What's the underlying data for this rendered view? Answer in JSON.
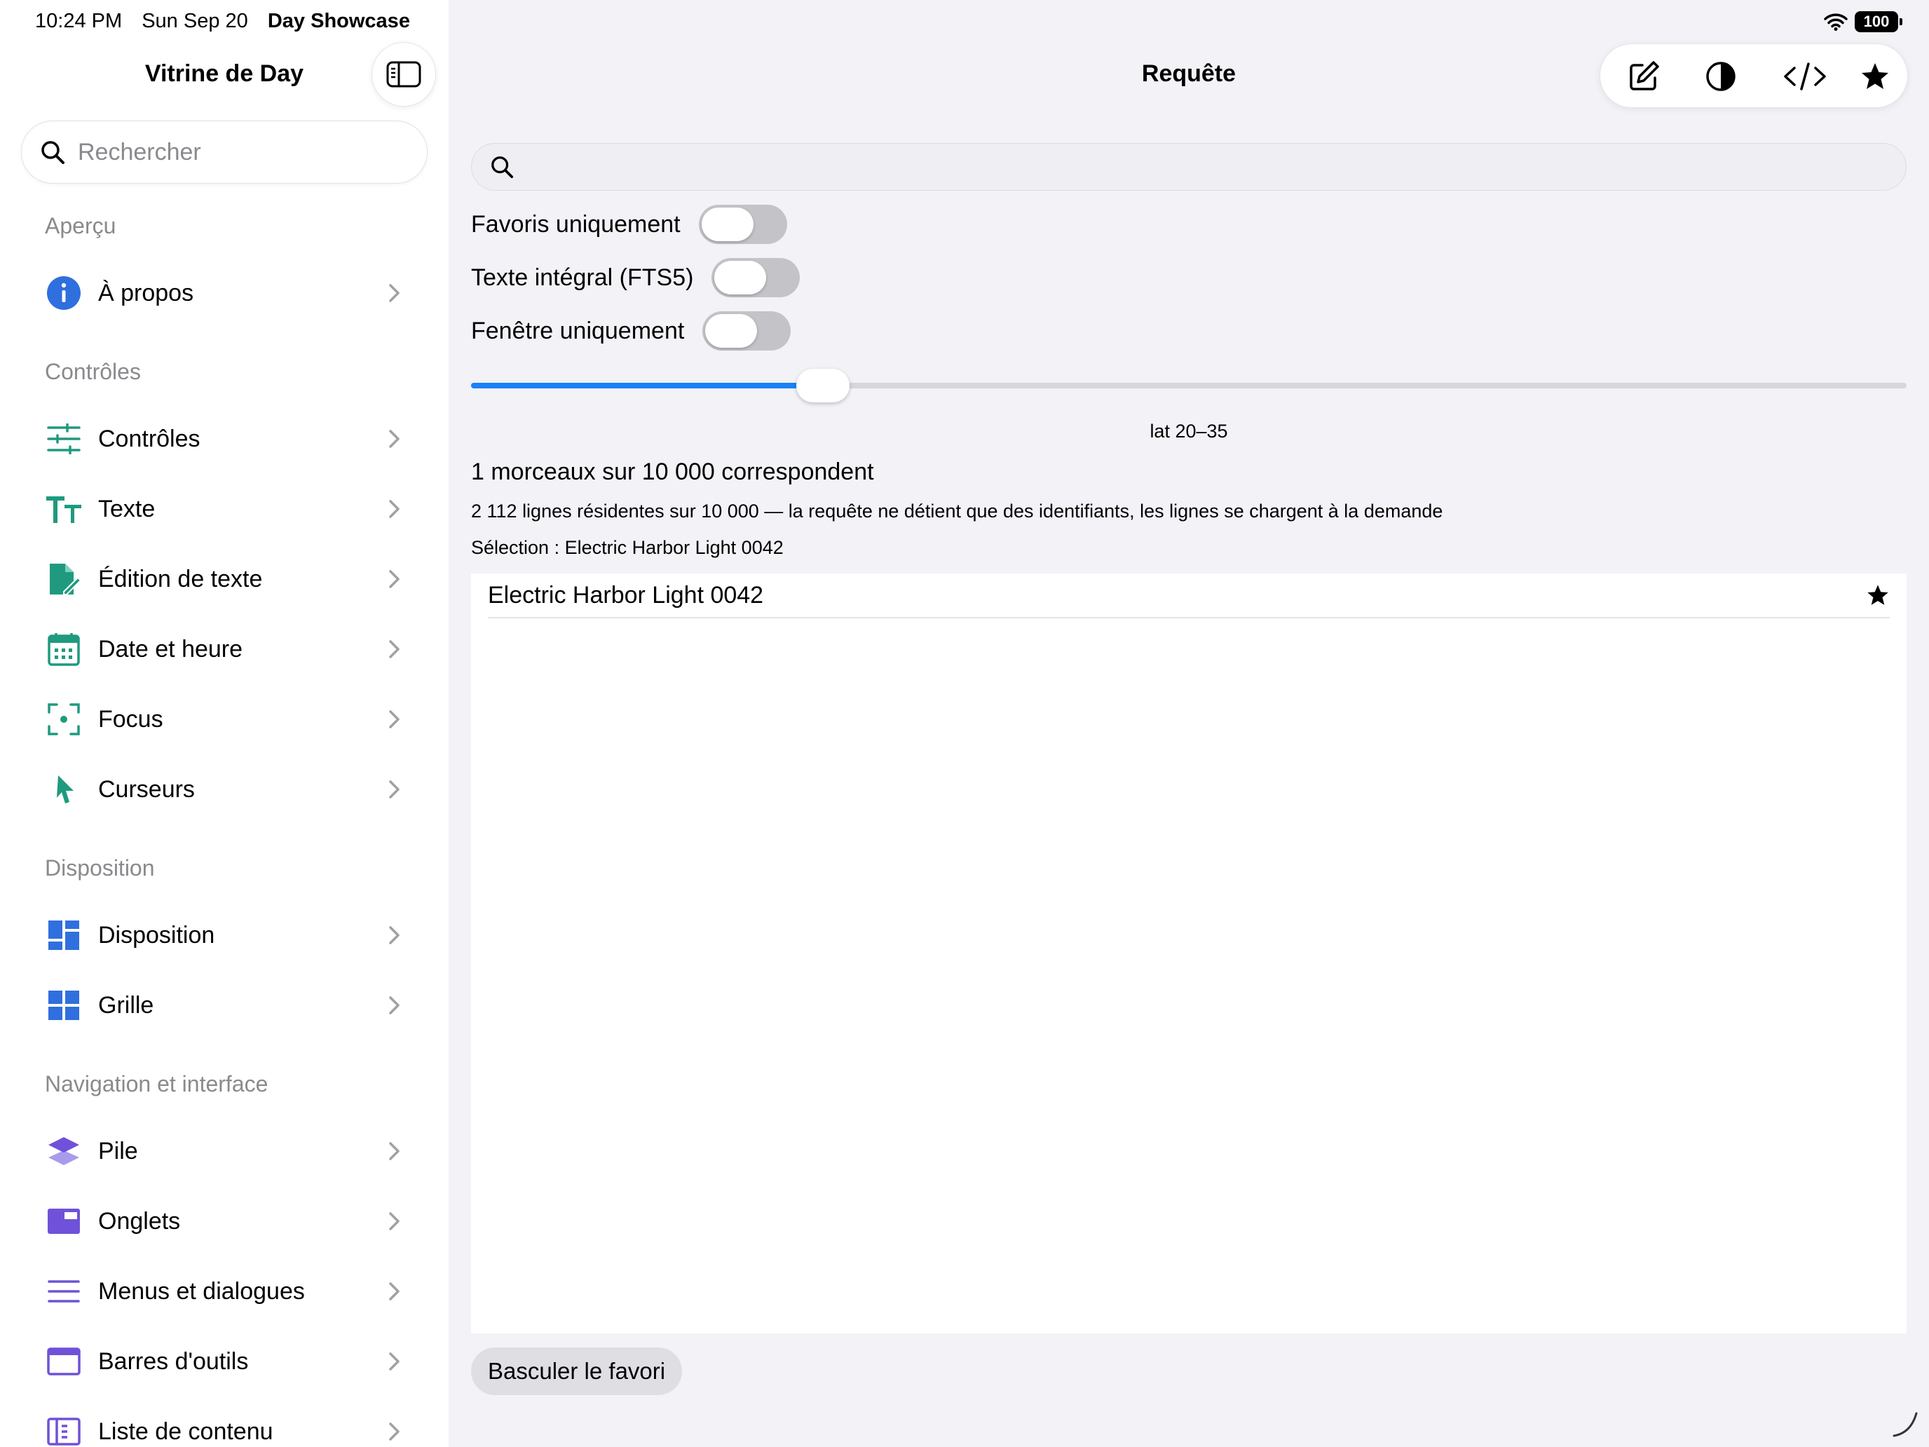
{
  "status_bar": {
    "time": "10:24 PM",
    "date": "Sun Sep 20",
    "app_name": "Day Showcase",
    "battery": "100"
  },
  "sidebar": {
    "title": "Vitrine de Day",
    "search_placeholder": "Rechercher",
    "sections": [
      {
        "header": "Aperçu",
        "items": [
          {
            "label": "À propos",
            "icon": "info-icon"
          }
        ]
      },
      {
        "header": "Contrôles",
        "items": [
          {
            "label": "Contrôles",
            "icon": "sliders-icon"
          },
          {
            "label": "Texte",
            "icon": "text-size-icon"
          },
          {
            "label": "Édition de texte",
            "icon": "document-edit-icon"
          },
          {
            "label": "Date et heure",
            "icon": "calendar-icon"
          },
          {
            "label": "Focus",
            "icon": "focus-viewfinder-icon"
          },
          {
            "label": "Curseurs",
            "icon": "pointer-icon"
          }
        ]
      },
      {
        "header": "Disposition",
        "items": [
          {
            "label": "Disposition",
            "icon": "layout-icon"
          },
          {
            "label": "Grille",
            "icon": "grid-icon"
          }
        ]
      },
      {
        "header": "Navigation et interface",
        "items": [
          {
            "label": "Pile",
            "icon": "stack-icon"
          },
          {
            "label": "Onglets",
            "icon": "tabs-icon"
          },
          {
            "label": "Menus et dialogues",
            "icon": "menu-lines-icon"
          },
          {
            "label": "Barres d'outils",
            "icon": "toolbar-window-icon"
          },
          {
            "label": "Liste de contenu",
            "icon": "content-list-icon"
          }
        ]
      }
    ]
  },
  "main": {
    "title": "Requête",
    "toolbar_icons": [
      "compose-icon",
      "contrast-icon",
      "code-icon",
      "star-icon"
    ],
    "search_value": "",
    "toggles": [
      {
        "label": "Favoris uniquement",
        "on": false
      },
      {
        "label": "Texte intégral (FTS5)",
        "on": false
      },
      {
        "label": "Fenêtre uniquement",
        "on": false
      }
    ],
    "slider": {
      "value_fraction": 0.245,
      "caption": "lat 20–35"
    },
    "match_count": "1 morceaux sur 10 000 correspondent",
    "resident_info": "2 112 lignes résidentes sur 10 000 — la requête ne détient que des identifiants, les lignes se chargent à la demande",
    "selection": "Sélection : Electric Harbor Light 0042",
    "results": [
      {
        "label": "Electric Harbor Light 0042",
        "favorite": true
      }
    ],
    "toggle_favorite_button": "Basculer le favori"
  },
  "colors": {
    "accent_blue": "#1a82f7",
    "icon_teal": "#1f9a7e",
    "icon_blue": "#2f6fde",
    "icon_purple": "#6f52d9"
  }
}
